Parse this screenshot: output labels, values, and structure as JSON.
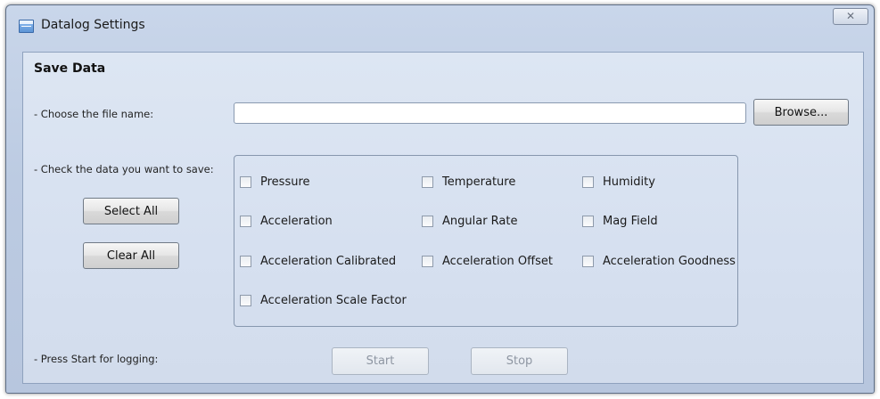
{
  "window": {
    "title": "Datalog Settings",
    "close_glyph": "✕",
    "icon": "window-icon"
  },
  "section": {
    "title": "Save Data"
  },
  "file": {
    "label": "- Choose the file name:",
    "value": "",
    "placeholder": "",
    "browse_label": "Browse..."
  },
  "check": {
    "label": "- Check the data you want to save:",
    "select_all_label": "Select All",
    "clear_all_label": "Clear All",
    "items": [
      {
        "label": "Pressure",
        "checked": false
      },
      {
        "label": "Temperature",
        "checked": false
      },
      {
        "label": "Humidity",
        "checked": false
      },
      {
        "label": "Acceleration",
        "checked": false
      },
      {
        "label": "Angular Rate",
        "checked": false
      },
      {
        "label": "Mag Field",
        "checked": false
      },
      {
        "label": "Acceleration Calibrated",
        "checked": false
      },
      {
        "label": "Acceleration Offset",
        "checked": false
      },
      {
        "label": "Acceleration Goodness",
        "checked": false
      },
      {
        "label": "Acceleration Scale Factor",
        "checked": false
      }
    ]
  },
  "logging": {
    "label": "- Press Start for logging:",
    "start_label": "Start",
    "stop_label": "Stop",
    "start_enabled": false,
    "stop_enabled": false
  }
}
